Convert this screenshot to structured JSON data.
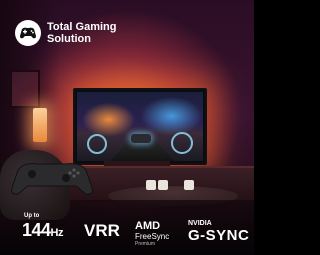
{
  "header": {
    "logo_icon": "gamepad-icon",
    "title_line1": "Total Gaming",
    "title_line2": "Solution"
  },
  "features": {
    "refresh_prefix": "Up to",
    "refresh_value": "144",
    "refresh_unit": "Hz",
    "vrr": "VRR",
    "amd_brand": "AMD",
    "amd_product": "FreeSync",
    "amd_tier": "Premium",
    "nvidia_brand": "NVIDIA",
    "nvidia_product": "G-SYNC"
  },
  "colors": {
    "ambilight": "#ff7a3c",
    "background": "#2a0d24",
    "text": "#ffffff"
  }
}
